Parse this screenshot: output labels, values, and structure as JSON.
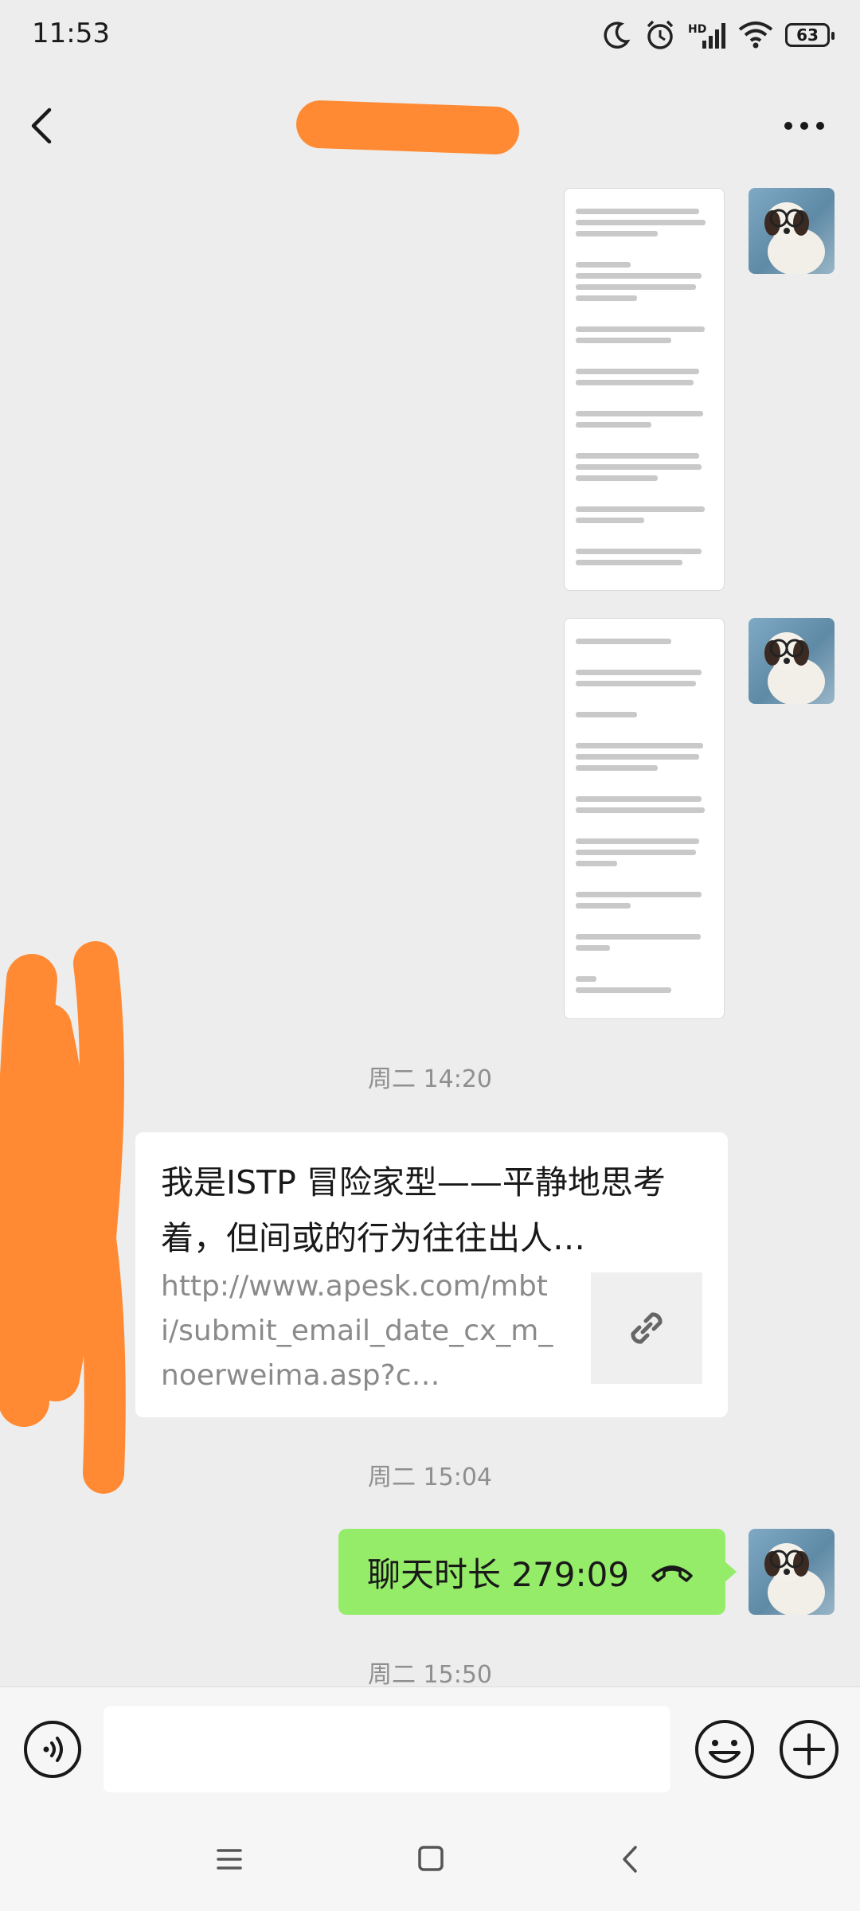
{
  "status_bar": {
    "time": "11:53",
    "network_badge": "HD",
    "battery_level": "63"
  },
  "header": {
    "title": "",
    "title_redacted": true
  },
  "messages": {
    "image_one": {
      "sender": "self",
      "type": "image-screenshot"
    },
    "image_two": {
      "sender": "self",
      "type": "image-screenshot"
    },
    "timestamp_one": "周二 14:20",
    "link_card": {
      "sender": "other",
      "title": "我是ISTP 冒险家型——平静地思考着，但间或的行为往往出人…",
      "url": "http://www.apesk.com/mbti/submit_email_date_cx_m_noerweima.asp?c…"
    },
    "timestamp_two": "周二 15:04",
    "call_record": {
      "sender": "self",
      "text": "聊天时长 279:09"
    },
    "timestamp_three": "周二 15:50"
  },
  "input_bar": {
    "placeholder": ""
  },
  "colors": {
    "background": "#ededed",
    "self_bubble": "#95ec69",
    "redaction": "#ff8a33",
    "timestamp": "#8f8f8f"
  },
  "icons": {
    "back": "chevron-left-icon",
    "more": "more-dots-icon",
    "voice": "voice-icon",
    "emoji": "emoji-icon",
    "plus": "plus-icon",
    "link": "link-icon",
    "hangup": "phone-hangup-icon"
  }
}
